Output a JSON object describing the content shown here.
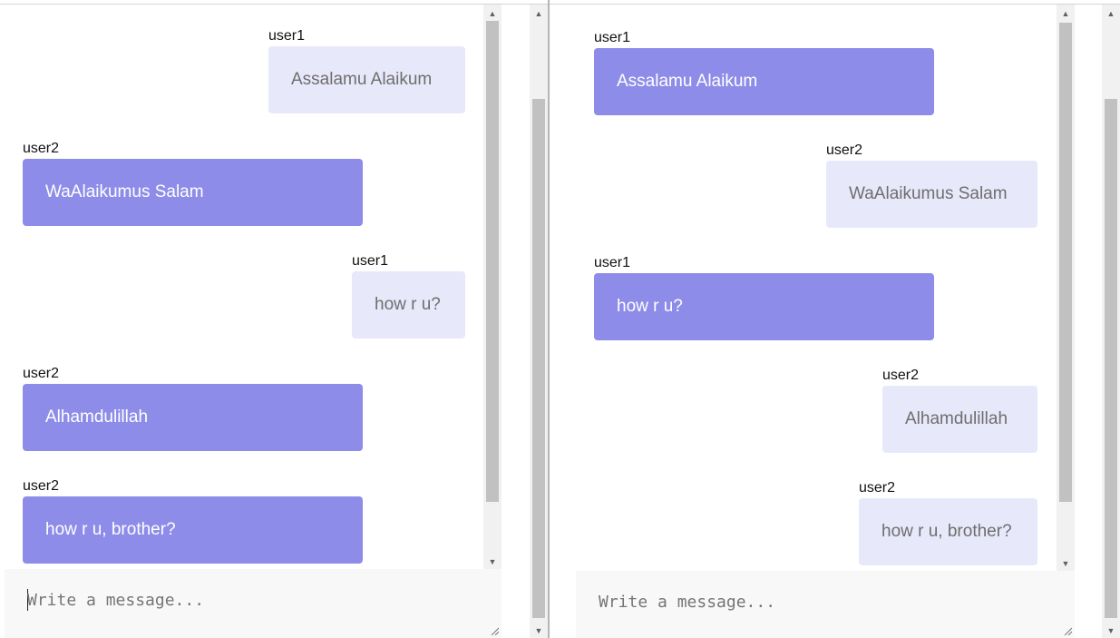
{
  "left_pane": {
    "messages": [
      {
        "user": "user1",
        "text": "Assalamu Alaikum",
        "side": "mine"
      },
      {
        "user": "user2",
        "text": "WaAlaikumus Salam",
        "side": "theirs"
      },
      {
        "user": "user1",
        "text": "how r u?",
        "side": "mine"
      },
      {
        "user": "user2",
        "text": "Alhamdulillah",
        "side": "theirs"
      },
      {
        "user": "user2",
        "text": "how r u, brother?",
        "side": "theirs"
      }
    ],
    "composer": {
      "placeholder": "Write a message...",
      "value": ""
    }
  },
  "right_pane": {
    "messages": [
      {
        "user": "user1",
        "text": "Assalamu Alaikum",
        "side": "theirs"
      },
      {
        "user": "user2",
        "text": "WaAlaikumus Salam",
        "side": "mine"
      },
      {
        "user": "user1",
        "text": "how r u?",
        "side": "theirs"
      },
      {
        "user": "user2",
        "text": "Alhamdulillah",
        "side": "mine"
      },
      {
        "user": "user2",
        "text": "how r u, brother?",
        "side": "mine"
      }
    ],
    "composer": {
      "placeholder": "Write a message...",
      "value": ""
    }
  },
  "icons": {
    "scroll_up": "scroll-up-arrow-icon",
    "scroll_down": "scroll-down-arrow-icon",
    "resize": "resize-grip-icon"
  },
  "colors": {
    "own_bubble": "#e8e8fb",
    "other_bubble": "#8e8ce9",
    "own_text": "#6e6e6e",
    "other_text": "#ffffff",
    "composer_bg": "#f8f8f8"
  }
}
